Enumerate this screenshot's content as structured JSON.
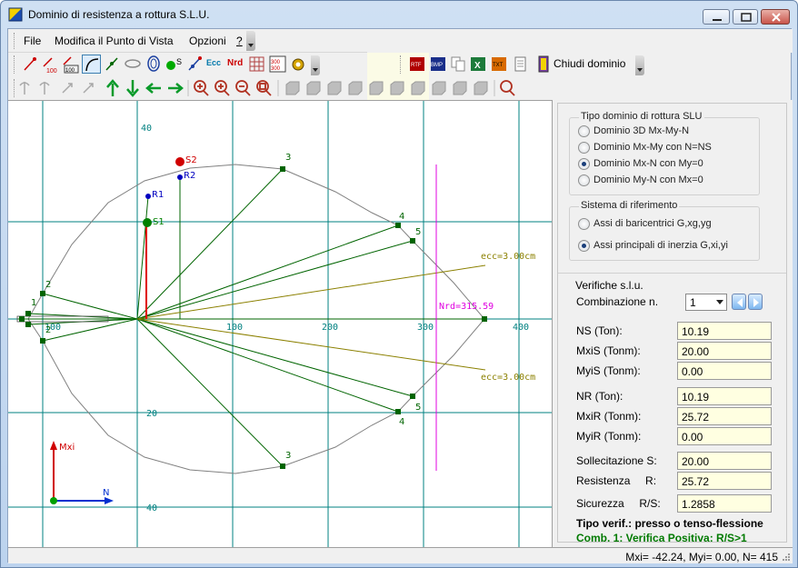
{
  "window": {
    "title": "Dominio di resistenza a rottura S.L.U."
  },
  "menu": {
    "items": [
      "File",
      "Modifica il Punto di Vista",
      "Opzioni",
      "?"
    ]
  },
  "toolbar": {
    "ecc_label": "Ecc",
    "nrd_label": "Nrd",
    "close_domain_label": "Chiudi dominio"
  },
  "plot": {
    "axis_labels": {
      "x_neg_100": "100",
      "x_100": "100",
      "x_200": "200",
      "x_300": "300",
      "x_400": "400",
      "y_top_40": "40",
      "y_bottom_20": "20",
      "y_bottom_40": "40"
    },
    "points": {
      "S2": "S2",
      "R2": "R2",
      "R1": "R1",
      "S1": "S1"
    },
    "node_numbers": {
      "n1": "1",
      "n2": "2",
      "n3": "3",
      "n4": "4",
      "n5": "5"
    },
    "ecc_upper": "ecc=3.00cm",
    "ecc_lower": "ecc=3.00cm",
    "nrd_label": "Nrd=315.59",
    "axis_icon": {
      "y_label": "Mxi",
      "x_label": "N"
    },
    "colors": {
      "grid": "#008080",
      "domain": "#808080",
      "segments": "#006400",
      "nrd": "#e000e0",
      "ecc": "#8b8000",
      "s_point": "#d00000",
      "r_point": "#0000c0"
    }
  },
  "panel": {
    "group1": {
      "title": "Tipo dominio di rottura SLU",
      "options": [
        "Dominio 3D Mx-My-N",
        "Dominio Mx-My con N=NS",
        "Dominio Mx-N con My=0",
        "Dominio My-N con Mx=0"
      ],
      "selected": 2
    },
    "group2": {
      "title": "Sistema di riferimento",
      "options": [
        "Assi di baricentrici G,xg,yg",
        "Assi principali di inerzia G,xi,yi"
      ],
      "selected": 1
    },
    "verifiche": {
      "title": "Verifiche s.l.u.",
      "combination_label": "Combinazione n.",
      "combination_value": "1",
      "NS_label": "NS (Ton):",
      "NS_value": "10.19",
      "MxiS_label": "MxiS (Tonm):",
      "MxiS_value": "20.00",
      "MyiS_label": "MyiS (Tonm):",
      "MyiS_value": "0.00",
      "NR_label": "NR (Ton):",
      "NR_value": "10.19",
      "MxiR_label": "MxiR (Tonm):",
      "MxiR_value": "25.72",
      "MyiR_label": "MyiR (Tonm):",
      "MyiR_value": "0.00",
      "sollecitazione_label": "Sollecitazione S:",
      "sollecitazione_value": "20.00",
      "resistenza_label": "Resistenza     R:",
      "resistenza_value": "25.72",
      "sicurezza_label": "Sicurezza     R/S:",
      "sicurezza_value": "1.2858",
      "tipo_verif": "Tipo verif.: presso o tenso-flessione",
      "esito": "Comb. 1: Verifica Positiva: R/S>1"
    }
  },
  "status": {
    "text": "Mxi= -42.24, Myi= 0.00, N= 415"
  }
}
